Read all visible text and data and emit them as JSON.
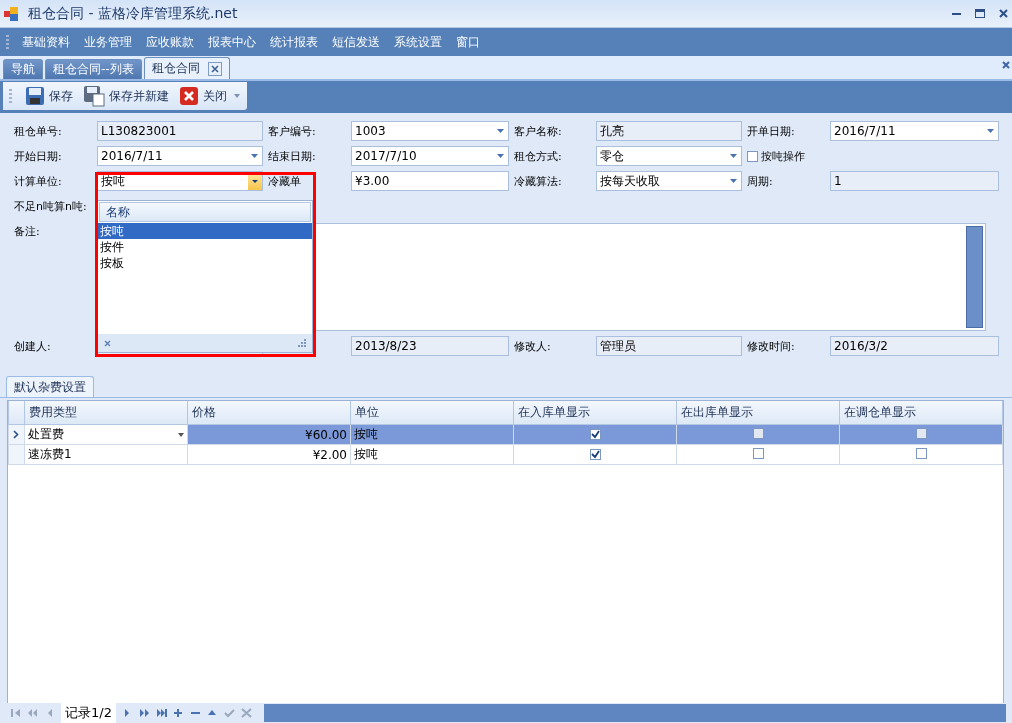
{
  "window": {
    "title": "租仓合同 - 蓝格冷库管理系统.net"
  },
  "menu": [
    "基础资料",
    "业务管理",
    "应收账款",
    "报表中心",
    "统计报表",
    "短信发送",
    "系统设置",
    "窗口"
  ],
  "doc_tabs": [
    {
      "label": "导航",
      "selected": false
    },
    {
      "label": "租仓合同--列表",
      "selected": false
    },
    {
      "label": "租仓合同",
      "selected": true
    }
  ],
  "toolbar": [
    {
      "label": "保存",
      "kind": "save"
    },
    {
      "label": "保存并新建",
      "kind": "save_new"
    },
    {
      "label": "关闭",
      "kind": "close"
    }
  ],
  "form_rows": [
    {
      "cells": [
        {
          "kind": "label",
          "text": "租仓单号:"
        },
        {
          "kind": "readonly",
          "value": "L130823001"
        },
        {
          "kind": "label",
          "text": "客户编号:"
        },
        {
          "kind": "combo",
          "value": "1003"
        },
        {
          "kind": "label",
          "text": "客户名称:"
        },
        {
          "kind": "readonly",
          "value": "孔亮"
        },
        {
          "kind": "label",
          "text": "开单日期:"
        },
        {
          "kind": "combo",
          "value": "2016/7/11"
        }
      ]
    },
    {
      "cells": [
        {
          "kind": "label",
          "text": "开始日期:"
        },
        {
          "kind": "combo",
          "value": "2016/7/11"
        },
        {
          "kind": "label",
          "text": "结束日期:"
        },
        {
          "kind": "combo",
          "value": "2017/7/10"
        },
        {
          "kind": "label",
          "text": "租仓方式:"
        },
        {
          "kind": "combo",
          "value": "零仓"
        },
        {
          "kind": "checkbox",
          "text": "按吨操作",
          "checked": false
        }
      ]
    },
    {
      "cells": [
        {
          "kind": "label",
          "text": "计算单位:"
        },
        {
          "kind": "combo",
          "value": "按吨",
          "open": true
        },
        {
          "kind": "label",
          "text": "冷藏单"
        },
        {
          "kind": "text",
          "value": "¥3.00"
        },
        {
          "kind": "label",
          "text": "冷藏算法:"
        },
        {
          "kind": "combo",
          "value": "按每天收取"
        },
        {
          "kind": "label",
          "text": "周期:"
        },
        {
          "kind": "readonly",
          "value": "1"
        }
      ]
    },
    {
      "cells": [
        {
          "kind": "label",
          "text": "不足n吨算n吨:"
        }
      ]
    },
    {
      "cells": [
        {
          "kind": "label",
          "text": "备注:"
        },
        {
          "kind": "memo"
        }
      ]
    },
    {
      "cells": [
        {
          "kind": "label",
          "text": "创建人:"
        },
        {
          "kind": "readonly"
        },
        {
          "kind": "blank"
        },
        {
          "kind": "readonly",
          "value": "2013/8/23"
        },
        {
          "kind": "label",
          "text": "修改人:"
        },
        {
          "kind": "readonly",
          "value": "管理员"
        },
        {
          "kind": "label",
          "text": "修改时间:"
        },
        {
          "kind": "readonly",
          "value": "2016/3/2"
        }
      ]
    }
  ],
  "dropdown": {
    "header": "名称",
    "items": [
      {
        "label": "按吨",
        "selected": true
      },
      {
        "label": "按件",
        "selected": false
      },
      {
        "label": "按板",
        "selected": false
      }
    ]
  },
  "grid_tab": "默认杂费设置",
  "grid": {
    "columns": [
      "费用类型",
      "价格",
      "单位",
      "在入库单显示",
      "在出库单显示",
      "在调仓单显示"
    ],
    "rows": [
      {
        "selected": true,
        "type": "处置费",
        "price": "¥60.00",
        "unit": "按吨",
        "in_stock": true,
        "out_stock": false,
        "transfer": false
      },
      {
        "selected": false,
        "type": "速冻费1",
        "price": "¥2.00",
        "unit": "按吨",
        "in_stock": true,
        "out_stock": false,
        "transfer": false
      }
    ]
  },
  "navigator": {
    "record": "记录1/2"
  }
}
